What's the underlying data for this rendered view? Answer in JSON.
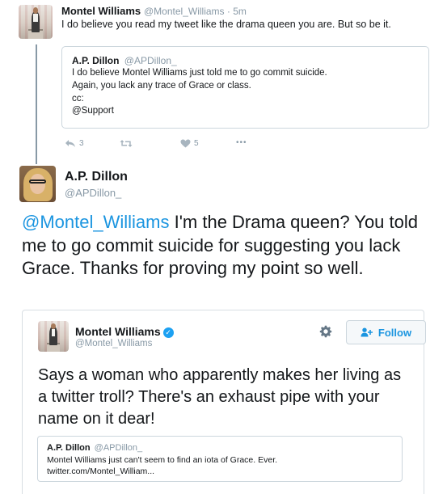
{
  "tweet1": {
    "author": "Montel Williams",
    "handle": "@Montel_Williams",
    "time": "· 5m",
    "text": "I do believe you read my tweet like the drama queen you are. But so be it.",
    "quoted": {
      "author": "A.P. Dillon",
      "handle": "@APDillon_",
      "lines": [
        "I do believe Montel Williams just told me to go commit suicide.",
        "Again, you lack any trace of Grace or class.",
        "cc:",
        "@Support"
      ]
    },
    "actions": {
      "reply_count": "3",
      "retweet_count": "",
      "like_count": "5",
      "more": "•••"
    }
  },
  "tweet2": {
    "author": "A.P. Dillon",
    "handle": "@APDillon_",
    "mention": "@Montel_Williams",
    "text_after_mention": " I'm the Drama queen? You told me to go commit suicide for suggesting you lack Grace. Thanks for proving my point so well."
  },
  "embedded": {
    "author": "Montel Williams",
    "verified_mark": "✓",
    "handle": "@Montel_Williams",
    "follow_label": "Follow",
    "text": "Says a woman who apparently makes her living as a twitter troll? There's an exhaust pipe with your name on it dear!",
    "quoted": {
      "author": "A.P. Dillon",
      "handle": "@APDillon_",
      "line1": "Montel Williams just can't seem to find an iota of Grace. Ever.",
      "line2": "twitter.com/Montel_William..."
    }
  },
  "colors": {
    "link": "#1b95e0",
    "muted": "#8899a6",
    "verified": "#1da1f2"
  },
  "icons": [
    "reply-icon",
    "retweet-icon",
    "heart-icon",
    "more-icon",
    "gear-icon",
    "follow-person-icon",
    "verified-icon"
  ]
}
